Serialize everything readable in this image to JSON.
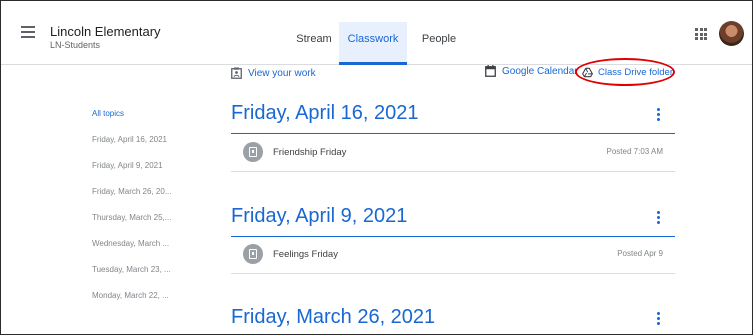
{
  "header": {
    "class_name": "Lincoln Elementary",
    "class_section": "LN-Students",
    "tabs": [
      {
        "label": "Stream"
      },
      {
        "label": "Classwork"
      },
      {
        "label": "People"
      }
    ],
    "active_tab": "Classwork"
  },
  "actions": {
    "view_work": "View your work",
    "google_calendar": "Google Calendar",
    "class_drive": "Class Drive folder"
  },
  "topics": [
    {
      "label": "All topics"
    },
    {
      "label": "Friday, April 16, 2021"
    },
    {
      "label": "Friday, April 9, 2021"
    },
    {
      "label": "Friday, March 26, 20..."
    },
    {
      "label": "Thursday, March 25,..."
    },
    {
      "label": "Wednesday, March ..."
    },
    {
      "label": "Tuesday, March 23, ..."
    },
    {
      "label": "Monday, March 22, ..."
    }
  ],
  "sections": [
    {
      "title": "Friday, April 16, 2021",
      "items": [
        {
          "title": "Friendship Friday",
          "meta": "Posted 7:03 AM"
        }
      ]
    },
    {
      "title": "Friday, April 9, 2021",
      "items": [
        {
          "title": "Feelings Friday",
          "meta": "Posted Apr 9"
        }
      ]
    },
    {
      "title": "Friday, March 26, 2021",
      "items": []
    }
  ],
  "colors": {
    "accent": "#1967d2",
    "highlight_circle": "#e00000",
    "tab_active_bg": "#e8f0fe"
  },
  "icons": [
    "menu-icon",
    "apps-grid-icon",
    "avatar",
    "view-work-icon",
    "calendar-icon",
    "drive-icon",
    "more-vert-icon",
    "assignment-icon"
  ]
}
